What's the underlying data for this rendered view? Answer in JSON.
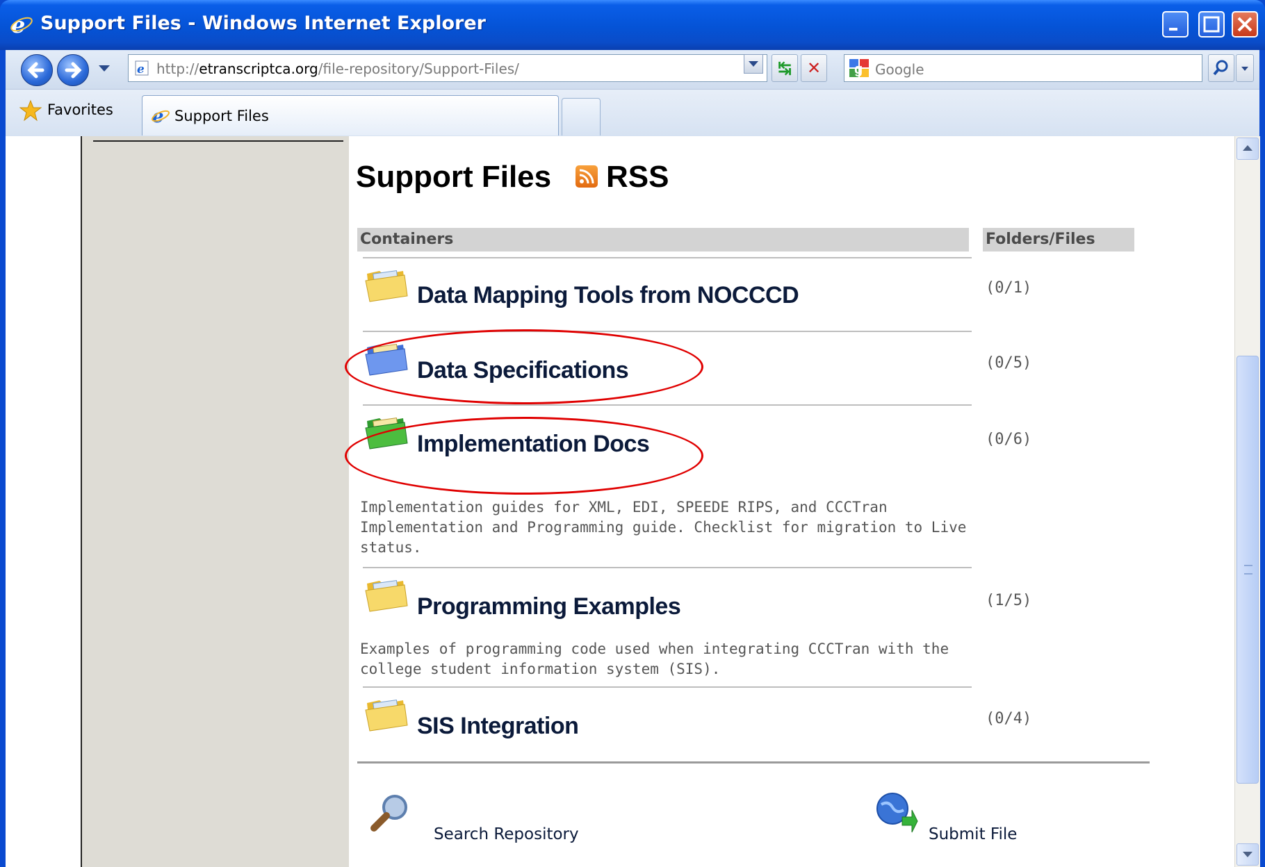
{
  "window": {
    "title": "Support Files - Windows Internet Explorer"
  },
  "toolbar": {
    "address_prefix": "http://",
    "address_domain": "etranscriptca.org",
    "address_path": "/file-repository/Support-Files/",
    "search_placeholder": "Google"
  },
  "favorites_bar": {
    "favorites_label": "Favorites",
    "active_tab_label": "Support Files"
  },
  "page": {
    "title": "Support Files",
    "rss_label": "RSS",
    "columns": {
      "containers": "Containers",
      "folders_files": "Folders/Files"
    },
    "containers": [
      {
        "title": "Data Mapping Tools from NOCCCD",
        "count": "(0/1)",
        "folder_color": "yellow",
        "description_lines": []
      },
      {
        "title": "Data Specifications",
        "count": "(0/5)",
        "folder_color": "blue",
        "description_lines": []
      },
      {
        "title": "Implementation Docs",
        "count": "(0/6)",
        "folder_color": "green",
        "description_lines": [
          "Implementation guides for XML, EDI, SPEEDE RIPS, and CCCTran",
          "Implementation and Programming guide.  Checklist for migration to Live status."
        ]
      },
      {
        "title": "Programming Examples",
        "count": "(1/5)",
        "folder_color": "yellow",
        "description_lines": [
          "Examples of programming code used when integrating CCCTran with the",
          "college student information system (SIS)."
        ]
      },
      {
        "title": "SIS Integration",
        "count": "(0/4)",
        "folder_color": "yellow",
        "description_lines": []
      }
    ],
    "footer": {
      "search_label": "Search Repository",
      "submit_label": "Submit File"
    }
  },
  "colors": {
    "highlight_ellipse": "#e00000",
    "titlebar_blue": "#0553d6",
    "left_nav_bg": "#dedcd5"
  }
}
